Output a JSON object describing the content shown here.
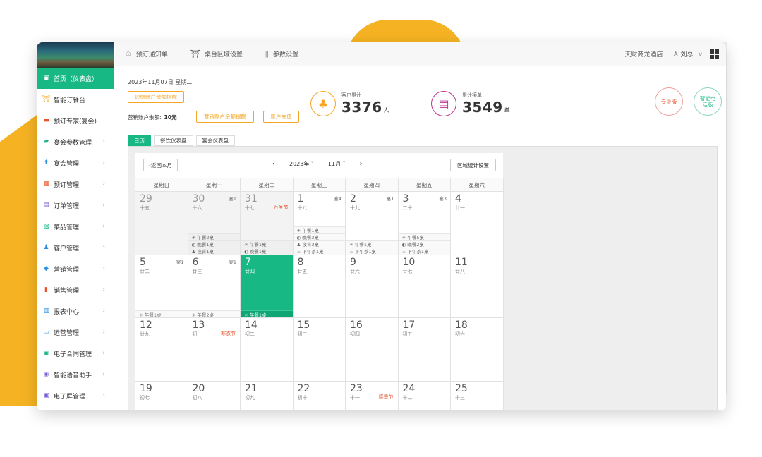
{
  "sidebar": {
    "items": [
      {
        "label": "首页（仪表盘）",
        "icon": "home-icon",
        "glyph": "▣",
        "color": "#ffffff",
        "active": true,
        "arrow": ""
      },
      {
        "label": "智能订餐台",
        "icon": "table-icon",
        "glyph": "⛩",
        "color": "#f5a623",
        "active": false,
        "arrow": ""
      },
      {
        "label": "预订专家(宴会)",
        "icon": "booking-expert-icon",
        "glyph": "▬",
        "color": "#e8532a",
        "active": false,
        "arrow": ""
      },
      {
        "label": "宴会参数管理",
        "icon": "banquet-params-icon",
        "glyph": "▰",
        "color": "#17b884",
        "active": false,
        "arrow": "›"
      },
      {
        "label": "宴会管理",
        "icon": "banquet-icon",
        "glyph": "⬆",
        "color": "#2a8fe0",
        "active": false,
        "arrow": "›"
      },
      {
        "label": "预订管理",
        "icon": "calendar-icon",
        "glyph": "▦",
        "color": "#e8532a",
        "active": false,
        "arrow": "›"
      },
      {
        "label": "订单管理",
        "icon": "order-icon",
        "glyph": "▤",
        "color": "#7b5fd6",
        "active": false,
        "arrow": "›"
      },
      {
        "label": "菜品管理",
        "icon": "dish-icon",
        "glyph": "▧",
        "color": "#17b884",
        "active": false,
        "arrow": "›"
      },
      {
        "label": "客户管理",
        "icon": "customer-icon",
        "glyph": "♟",
        "color": "#2a8fe0",
        "active": false,
        "arrow": "›"
      },
      {
        "label": "营销管理",
        "icon": "marketing-icon",
        "glyph": "◆",
        "color": "#2a8fe0",
        "active": false,
        "arrow": "›"
      },
      {
        "label": "销售管理",
        "icon": "sales-icon",
        "glyph": "▮",
        "color": "#e8532a",
        "active": false,
        "arrow": "›"
      },
      {
        "label": "报表中心",
        "icon": "report-icon",
        "glyph": "▥",
        "color": "#2a8fe0",
        "active": false,
        "arrow": "›"
      },
      {
        "label": "运营管理",
        "icon": "monitor-icon",
        "glyph": "▭",
        "color": "#2a8fe0",
        "active": false,
        "arrow": "›"
      },
      {
        "label": "电子合同管理",
        "icon": "contract-icon",
        "glyph": "▣",
        "color": "#17b884",
        "active": false,
        "arrow": "›"
      },
      {
        "label": "智能语音助手",
        "icon": "voice-assistant-icon",
        "glyph": "◉",
        "color": "#7b5fd6",
        "active": false,
        "arrow": "›"
      },
      {
        "label": "电子屏管理",
        "icon": "screen-icon",
        "glyph": "▣",
        "color": "#7b5fd6",
        "active": false,
        "arrow": "›"
      }
    ]
  },
  "topbar": {
    "items": [
      {
        "label": "预订通知单",
        "icon": "bell-icon",
        "glyph": "♤"
      },
      {
        "label": "桌台区域设置",
        "icon": "gate-icon",
        "glyph": "⛩"
      },
      {
        "label": "参数设置",
        "icon": "sliders-icon",
        "glyph": "⫵"
      }
    ],
    "hotel": "天财商龙酒店",
    "user": "刘总",
    "user_caret": "∨"
  },
  "content": {
    "date_line": "2023年11月07日 星期二",
    "sms_balance_btn": "短信账户余额提醒",
    "acct_label": "营销账户余额:",
    "acct_value": "10元",
    "marketing_btn": "营销账户余额提醒",
    "recharge_btn": "账户充值",
    "stats": [
      {
        "label": "客户累计",
        "value": "3376",
        "unit": "人",
        "color": "#f5a623",
        "icon": "customers-icon",
        "glyph": "♣"
      },
      {
        "label": "累计接单",
        "value": "3549",
        "unit": "单",
        "color": "#c2318a",
        "icon": "orders-icon",
        "glyph": "▤"
      }
    ],
    "versions": [
      {
        "label": "专业版",
        "color": "#e8532a",
        "border": "#f0a0a0"
      },
      {
        "label": "智能电话版",
        "color": "#17b884",
        "border": "#8fd6b8"
      }
    ],
    "tabs": [
      "日历",
      "餐饮仪表盘",
      "宴会仪表盘"
    ]
  },
  "calendar": {
    "back_label": "‹返回本月",
    "prev": "‹",
    "next": "›",
    "year": "2023年",
    "month": "11月",
    "caret": "˅",
    "zone_label": "区域统计设置",
    "weekdays": [
      "星期日",
      "星期一",
      "星期二",
      "星期三",
      "星期四",
      "星期五",
      "星期六"
    ],
    "days": [
      {
        "day": "29",
        "lunar": "十五",
        "other": true,
        "fest": "",
        "bq": "",
        "events": []
      },
      {
        "day": "30",
        "lunar": "十六",
        "other": true,
        "fest": "",
        "bq": "宴1",
        "events": [
          "☀ 午餐2桌",
          "◐ 晚餐1桌",
          "♟ 夜宵1桌"
        ]
      },
      {
        "day": "31",
        "lunar": "十七",
        "other": true,
        "fest": "万圣节",
        "bq": "",
        "events": [
          "☀ 午餐1桌",
          "◐ 晚餐1桌"
        ]
      },
      {
        "day": "1",
        "lunar": "十八",
        "other": false,
        "fest": "",
        "bq": "宴4",
        "events": [
          "☀ 午餐1桌",
          "◐ 晚餐3桌",
          "♟ 夜宵3桌",
          "☕ 下午茶1桌"
        ]
      },
      {
        "day": "2",
        "lunar": "十九",
        "other": false,
        "fest": "",
        "bq": "宴1",
        "events": [
          "☀ 午餐1桌",
          "☕ 下午茶1桌"
        ]
      },
      {
        "day": "3",
        "lunar": "二十",
        "other": false,
        "fest": "",
        "bq": "宴3",
        "events": [
          "☀ 午餐5桌",
          "◐ 晚餐2桌",
          "☕ 下午茶1桌"
        ]
      },
      {
        "day": "4",
        "lunar": "廿一",
        "other": false,
        "fest": "",
        "bq": "",
        "events": []
      },
      {
        "day": "5",
        "lunar": "廿二",
        "other": false,
        "fest": "",
        "bq": "宴1",
        "events": [
          "☀ 午餐1桌"
        ]
      },
      {
        "day": "6",
        "lunar": "廿三",
        "other": false,
        "fest": "",
        "bq": "宴1",
        "events": [
          "☀ 午餐2桌"
        ]
      },
      {
        "day": "7",
        "lunar": "廿四",
        "other": false,
        "today": true,
        "fest": "",
        "bq": "",
        "events": [
          "☀ 午餐1桌"
        ]
      },
      {
        "day": "8",
        "lunar": "廿五",
        "other": false,
        "fest": "",
        "bq": "",
        "events": []
      },
      {
        "day": "9",
        "lunar": "廿六",
        "other": false,
        "fest": "",
        "bq": "",
        "events": []
      },
      {
        "day": "10",
        "lunar": "廿七",
        "other": false,
        "fest": "",
        "bq": "",
        "events": []
      },
      {
        "day": "11",
        "lunar": "廿八",
        "other": false,
        "fest": "",
        "bq": "",
        "events": []
      },
      {
        "day": "12",
        "lunar": "廿九",
        "other": false,
        "fest": "",
        "bq": "",
        "events": []
      },
      {
        "day": "13",
        "lunar": "初一",
        "other": false,
        "fest": "寒衣节",
        "bq": "",
        "events": []
      },
      {
        "day": "14",
        "lunar": "初二",
        "other": false,
        "fest": "",
        "bq": "",
        "events": []
      },
      {
        "day": "15",
        "lunar": "初三",
        "other": false,
        "fest": "",
        "bq": "",
        "events": []
      },
      {
        "day": "16",
        "lunar": "初四",
        "other": false,
        "fest": "",
        "bq": "",
        "events": []
      },
      {
        "day": "17",
        "lunar": "初五",
        "other": false,
        "fest": "",
        "bq": "",
        "events": []
      },
      {
        "day": "18",
        "lunar": "初六",
        "other": false,
        "fest": "",
        "bq": "",
        "events": []
      },
      {
        "day": "19",
        "lunar": "初七",
        "other": false,
        "fest": "",
        "bq": "",
        "events": []
      },
      {
        "day": "20",
        "lunar": "初八",
        "other": false,
        "fest": "",
        "bq": "",
        "events": []
      },
      {
        "day": "21",
        "lunar": "初九",
        "other": false,
        "fest": "",
        "bq": "",
        "events": []
      },
      {
        "day": "22",
        "lunar": "初十",
        "other": false,
        "fest": "",
        "bq": "",
        "events": []
      },
      {
        "day": "23",
        "lunar": "十一",
        "other": false,
        "fest": "感恩节",
        "bq": "",
        "events": []
      },
      {
        "day": "24",
        "lunar": "十二",
        "other": false,
        "fest": "",
        "bq": "",
        "events": []
      },
      {
        "day": "25",
        "lunar": "十三",
        "other": false,
        "fest": "",
        "bq": "",
        "events": []
      }
    ]
  }
}
